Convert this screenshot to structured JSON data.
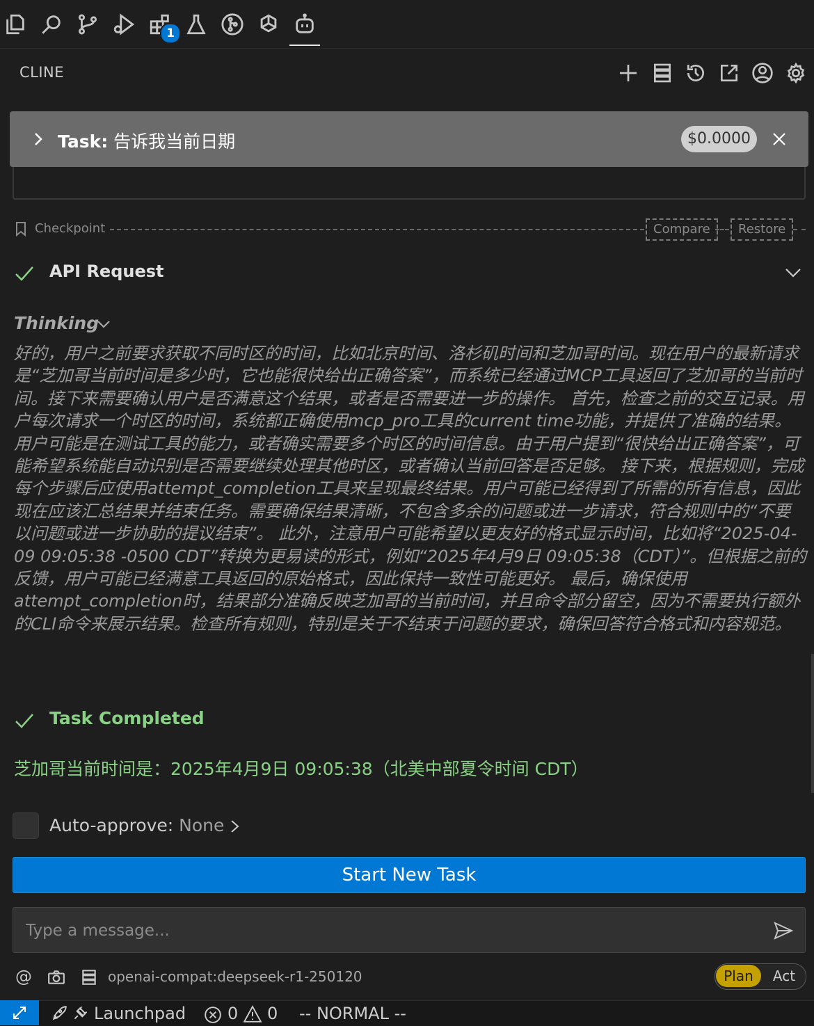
{
  "activity_bar": {
    "icons": [
      "explorer-icon",
      "search-icon",
      "source-control-icon",
      "run-debug-icon",
      "extensions-icon",
      "testing-icon",
      "gitlens-icon",
      "openai-icon",
      "cline-robot-icon"
    ],
    "extensions_badge": "1"
  },
  "header": {
    "title": "CLINE",
    "icons": [
      "plus-icon",
      "mcp-servers-icon",
      "history-icon",
      "popout-icon",
      "account-icon",
      "settings-icon"
    ]
  },
  "task": {
    "prefix": "Task:",
    "title": "告诉我当前日期",
    "cost": "$0.0000"
  },
  "checkpoint": {
    "label": "Checkpoint",
    "compare": "Compare",
    "restore": "Restore"
  },
  "api_request": {
    "label": "API Request"
  },
  "thinking": {
    "label": "Thinking",
    "text": "好的，用户之前要求获取不同时区的时间，比如北京时间、洛杉矶时间和芝加哥时间。现在用户的最新请求是“芝加哥当前时间是多少时，它也能很快给出正确答案”，而系统已经通过MCP工具返回了芝加哥的当前时间。接下来需要确认用户是否满意这个结果，或者是否需要进一步的操作。 首先，检查之前的交互记录。用户每次请求一个时区的时间，系统都正确使用mcp_pro工具的current time功能，并提供了准确的结果。用户可能是在测试工具的能力，或者确实需要多个时区的时间信息。由于用户提到“很快给出正确答案”，可能希望系统能自动识别是否需要继续处理其他时区，或者确认当前回答是否足够。 接下来，根据规则，完成每个步骤后应使用attempt_completion工具来呈现最终结果。用户可能已经得到了所需的所有信息，因此现在应该汇总结果并结束任务。需要确保结果清晰，不包含多余的问题或进一步请求，符合规则中的“不要以问题或进一步协助的提议结束”。 此外，注意用户可能希望以更友好的格式显示时间，比如将“2025-04-09 09:05:38 -0500 CDT”转换为更易读的形式，例如“2025年4月9日 09:05:38（CDT）”。但根据之前的反馈，用户可能已经满意工具返回的原始格式，因此保持一致性可能更好。 最后，确保使用attempt_completion时，结果部分准确反映芝加哥的当前时间，并且命令部分留空，因为不需要执行额外的CLI命令来展示结果。检查所有规则，特别是关于不结束于问题的要求，确保回答符合格式和内容规范。"
  },
  "completion": {
    "label": "Task Completed",
    "result": "芝加哥当前时间是：2025年4月9日 09:05:38（北美中部夏令时间 CDT）"
  },
  "auto_approve": {
    "label": "Auto-approve:",
    "value": "None"
  },
  "start_button": "Start New Task",
  "message": {
    "placeholder": "Type a message..."
  },
  "toolbar": {
    "at": "@",
    "model": "openai-compat:deepseek-r1-250120",
    "plan": "Plan",
    "act": "Act"
  },
  "status_bar": {
    "launchpad": "Launchpad",
    "errors": "0",
    "warnings": "0",
    "vim_mode": "-- NORMAL --"
  },
  "colors": {
    "accent": "#0078d4",
    "success": "#89d185",
    "plan": "#c4a000"
  }
}
